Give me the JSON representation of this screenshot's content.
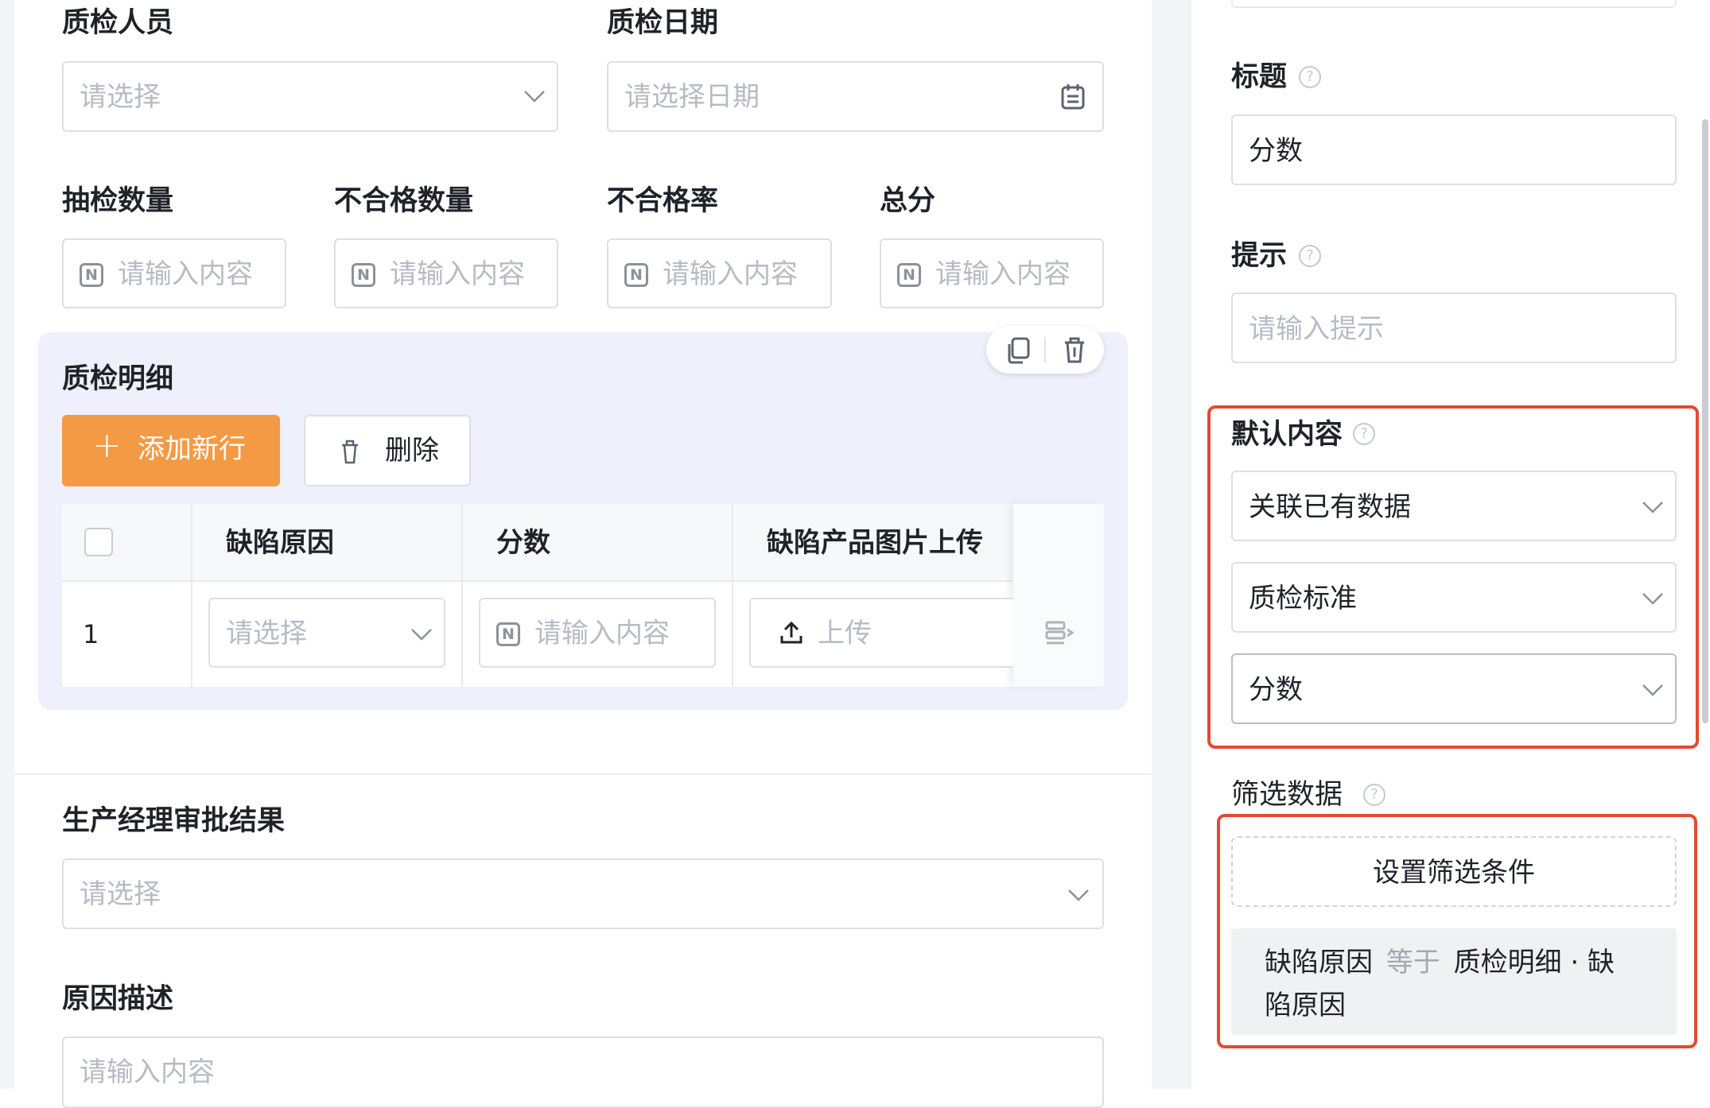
{
  "form": {
    "inspector": {
      "label": "质检人员",
      "placeholder": "请选择"
    },
    "date": {
      "label": "质检日期",
      "placeholder": "请选择日期"
    },
    "sample_qty": {
      "label": "抽检数量",
      "placeholder": "请输入内容"
    },
    "fail_qty": {
      "label": "不合格数量",
      "placeholder": "请输入内容"
    },
    "fail_rate": {
      "label": "不合格率",
      "placeholder": "请输入内容"
    },
    "total_score": {
      "label": "总分",
      "placeholder": "请输入内容"
    },
    "number_icon": "N",
    "detail": {
      "title": "质检明细",
      "add_button": "添加新行",
      "delete_button": "删除",
      "columns": [
        "缺陷原因",
        "分数",
        "缺陷产品图片上传"
      ],
      "rows": [
        {
          "index": "1",
          "reason_placeholder": "请选择",
          "score_placeholder": "请输入内容",
          "upload_label": "上传"
        }
      ]
    },
    "manager_result": {
      "label": "生产经理审批结果",
      "placeholder": "请选择"
    },
    "reason_desc": {
      "label": "原因描述",
      "placeholder": "请输入内容"
    }
  },
  "panel": {
    "title_field": {
      "label": "标题",
      "value": "分数"
    },
    "hint_field": {
      "label": "提示",
      "placeholder": "请输入提示"
    },
    "default_content": {
      "label": "默认内容",
      "selects": [
        "关联已有数据",
        "质检标准",
        "分数"
      ]
    },
    "filter": {
      "label": "筛选数据",
      "button": "设置筛选条件",
      "condition": {
        "field": "缺陷原因",
        "operator": "等于",
        "value_line1": "质检明细 · 缺",
        "value_line2": "陷原因"
      }
    },
    "help_icon": "?",
    "highlight_color": "#e34a33"
  },
  "colors": {
    "accent": "#f49a44",
    "card_bg": "#eef0fb"
  }
}
